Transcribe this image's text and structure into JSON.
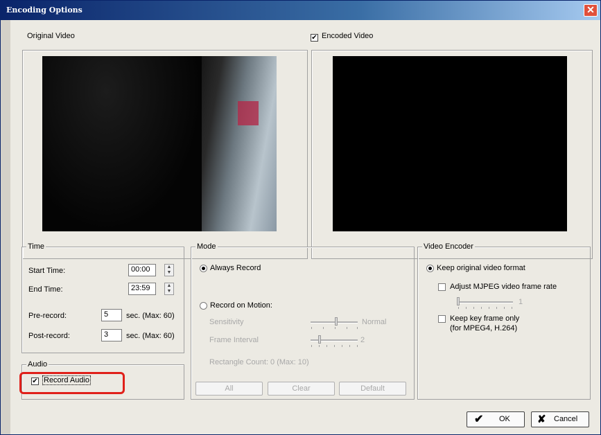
{
  "window": {
    "title": "Encoding Options",
    "close_label": "✕"
  },
  "video": {
    "original_label": "Original Video",
    "encoded_label": "Encoded Video",
    "encoded_checked": true
  },
  "time": {
    "group_title": "Time",
    "start_label": "Start Time:",
    "start_value": "00:00",
    "end_label": "End Time:",
    "end_value": "23:59",
    "pre_label": "Pre-record:",
    "pre_value": "5",
    "post_label": "Post-record:",
    "post_value": "3",
    "unit_note": "sec. (Max: 60)"
  },
  "audio": {
    "group_title": "Audio",
    "record_label": "Record Audio",
    "record_checked": true
  },
  "mode": {
    "group_title": "Mode",
    "always_label": "Always Record",
    "motion_label": "Record on Motion:",
    "sensitivity_label": "Sensitivity",
    "sensitivity_value": "Normal",
    "frame_interval_label": "Frame Interval",
    "frame_interval_value": "2",
    "rect_count_label": "Rectangle Count: 0  (Max: 10)",
    "all_button": "All",
    "clear_button": "Clear",
    "default_button": "Default"
  },
  "encoder": {
    "group_title": "Video Encoder",
    "keep_original_label": "Keep original video format",
    "adjust_mjpeg_label": "Adjust MJPEG video frame rate",
    "mjpeg_value": "1",
    "keyframe_label": "Keep key frame only",
    "keyframe_note": "(for MPEG4, H.264)"
  },
  "footer": {
    "ok_label": "OK",
    "cancel_label": "Cancel",
    "ok_icon": "checkmark-icon",
    "cancel_icon": "x-icon"
  },
  "colors": {
    "highlight": "#e0201a",
    "title_bar": "#0a246a"
  }
}
